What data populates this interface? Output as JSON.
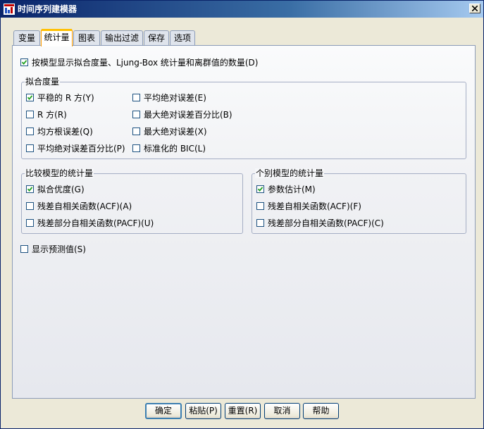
{
  "window": {
    "title": "时间序列建模器"
  },
  "tabs": [
    "变量",
    "统计量",
    "图表",
    "输出过滤",
    "保存",
    "选项"
  ],
  "active_tab": 1,
  "display_fit": {
    "label": "按模型显示拟合度量、Ljung-Box 统计量和离群值的数量(D)",
    "checked": true
  },
  "fit_measures": {
    "title": "拟合度量",
    "items": [
      {
        "label": "平稳的 R 方(Y)",
        "checked": true
      },
      {
        "label": "R 方(R)",
        "checked": false
      },
      {
        "label": "均方根误差(Q)",
        "checked": false
      },
      {
        "label": "平均绝对误差百分比(P)",
        "checked": false
      },
      {
        "label": "平均绝对误差(E)",
        "checked": false
      },
      {
        "label": "最大绝对误差百分比(B)",
        "checked": false
      },
      {
        "label": "最大绝对误差(X)",
        "checked": false
      },
      {
        "label": "标准化的 BIC(L)",
        "checked": false
      }
    ]
  },
  "compare_models": {
    "title": "比较模型的统计量",
    "items": [
      {
        "label": "拟合优度(G)",
        "checked": true
      },
      {
        "label": "残差自相关函数(ACF)(A)",
        "checked": false
      },
      {
        "label": "残差部分自相关函数(PACF)(U)",
        "checked": false
      }
    ]
  },
  "individual_models": {
    "title": "个别模型的统计量",
    "items": [
      {
        "label": "参数估计(M)",
        "checked": true
      },
      {
        "label": "残差自相关函数(ACF)(F)",
        "checked": false
      },
      {
        "label": "残差部分自相关函数(PACF)(C)",
        "checked": false
      }
    ]
  },
  "show_forecasts": {
    "label": "显示预测值(S)",
    "checked": false
  },
  "buttons": {
    "ok": "确定",
    "paste": "粘贴(P)",
    "reset": "重置(R)",
    "cancel": "取消",
    "help": "帮助"
  },
  "colors": {
    "titlebar": "#0a246a",
    "active_tab": "#ff9c00",
    "check": "#21a121"
  }
}
